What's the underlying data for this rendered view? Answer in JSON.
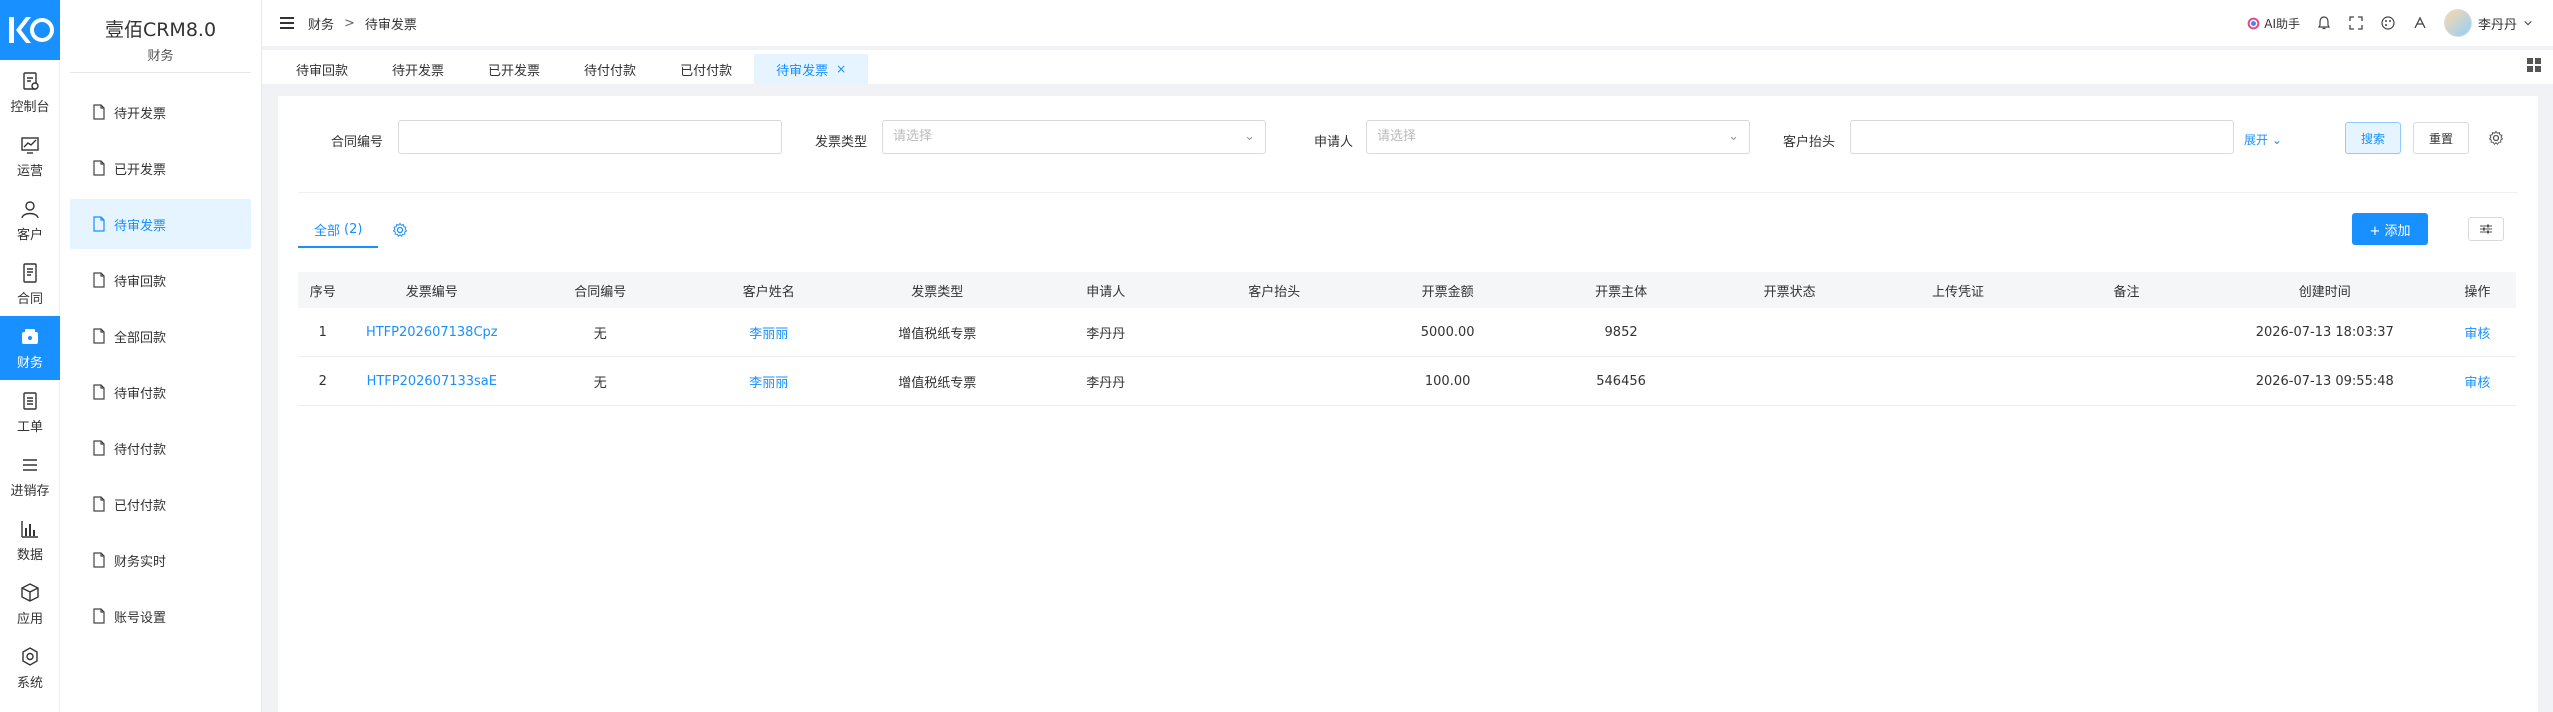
{
  "app": {
    "brand": "壹佰CRM8.0",
    "section": "财务"
  },
  "colors": {
    "primary": "#1890ff",
    "active_bg": "#e6f4ff"
  },
  "rail": [
    {
      "label": "控制台",
      "icon": "dashboard-icon"
    },
    {
      "label": "运营",
      "icon": "chart-icon"
    },
    {
      "label": "客户",
      "icon": "user-icon"
    },
    {
      "label": "合同",
      "icon": "contract-icon"
    },
    {
      "label": "财务",
      "icon": "wallet-icon",
      "active": true
    },
    {
      "label": "工单",
      "icon": "ticket-icon"
    },
    {
      "label": "进销存",
      "icon": "list-icon"
    },
    {
      "label": "数据",
      "icon": "bar-chart-icon"
    },
    {
      "label": "应用",
      "icon": "cube-icon"
    },
    {
      "label": "系统",
      "icon": "settings-icon"
    }
  ],
  "submenu": [
    {
      "label": "待开发票"
    },
    {
      "label": "已开发票"
    },
    {
      "label": "待审发票",
      "active": true
    },
    {
      "label": "待审回款"
    },
    {
      "label": "全部回款"
    },
    {
      "label": "待审付款"
    },
    {
      "label": "待付付款"
    },
    {
      "label": "已付付款"
    },
    {
      "label": "财务实时"
    },
    {
      "label": "账号设置"
    }
  ],
  "breadcrumb": {
    "first": "财务",
    "sep": ">",
    "current": "待审发票"
  },
  "header": {
    "ai_label": "AI助手",
    "user_name": "李丹丹"
  },
  "page_tabs": [
    {
      "label": "待审回款"
    },
    {
      "label": "待开发票"
    },
    {
      "label": "已开发票"
    },
    {
      "label": "待付付款"
    },
    {
      "label": "已付付款"
    },
    {
      "label": "待审发票",
      "active": true,
      "close": "×"
    }
  ],
  "filters": {
    "contract_no_label": "合同编号",
    "contract_no_value": "",
    "invoice_type_label": "发票类型",
    "invoice_type_placeholder": "请选择",
    "applicant_label": "申请人",
    "applicant_placeholder": "请选择",
    "customer_title_label": "客户抬头",
    "customer_title_value": "",
    "expand_label": "展开",
    "search_label": "搜索",
    "reset_label": "重置"
  },
  "view_tabs": {
    "all_label": "全部",
    "all_count": "(2)"
  },
  "toolbar": {
    "add_label": "+ 添加"
  },
  "table": {
    "headers": [
      "序号",
      "发票编号",
      "合同编号",
      "客户姓名",
      "发票类型",
      "申请人",
      "客户抬头",
      "开票金额",
      "开票主体",
      "开票状态",
      "上传凭证",
      "备注",
      "创建时间",
      "操作"
    ],
    "rows": [
      [
        "1",
        "HTFP202607138Cpz",
        "无",
        "李丽丽",
        "增值税纸专票",
        "李丹丹",
        "",
        "5000.00",
        "9852",
        "",
        "",
        "",
        "2026-07-13 18:03:37",
        "审核"
      ],
      [
        "2",
        "HTFP202607133saE",
        "无",
        "李丽丽",
        "增值税纸专票",
        "李丹丹",
        "",
        "100.00",
        "546456",
        "",
        "",
        "",
        "2026-07-13 09:55:48",
        "审核"
      ]
    ]
  }
}
